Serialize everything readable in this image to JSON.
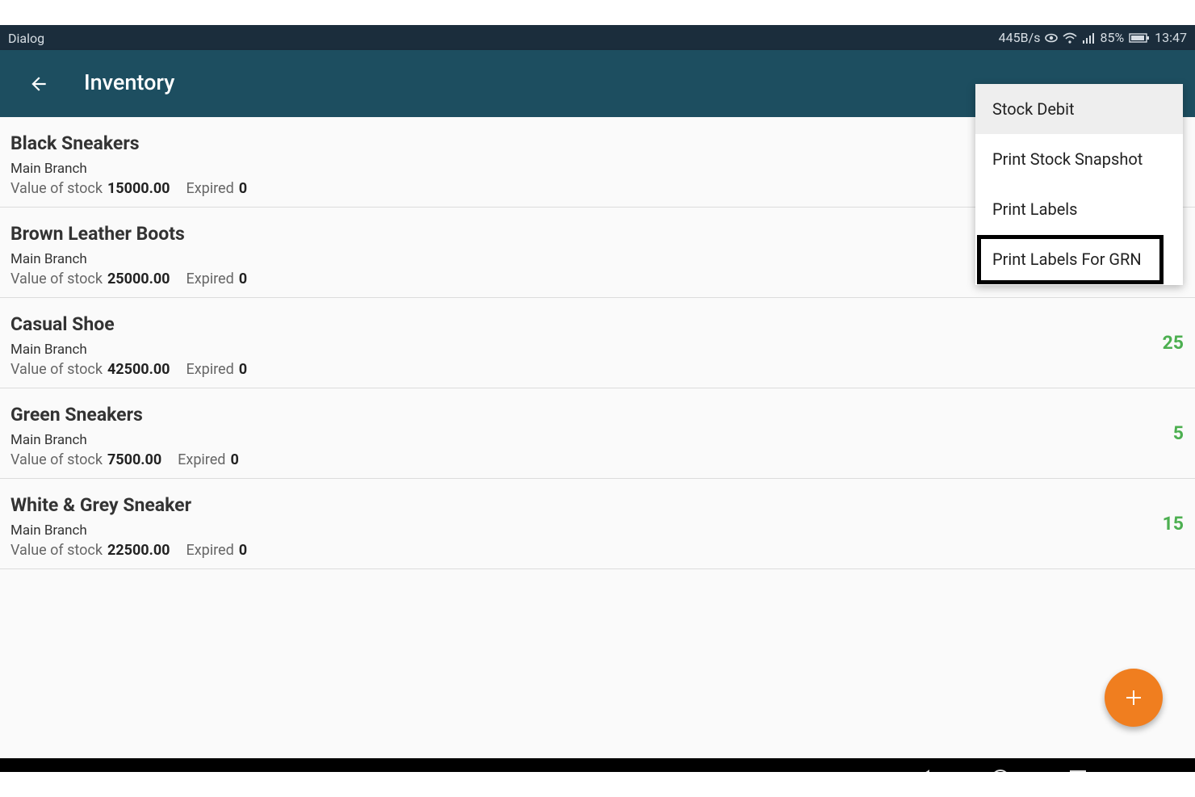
{
  "status_bar": {
    "carrier": "Dialog",
    "net_speed": "445B/s",
    "battery": "85%",
    "time": "13:47"
  },
  "app_bar": {
    "title": "Inventory"
  },
  "items": [
    {
      "name": "Black Sneakers",
      "branch": "Main Branch",
      "value_label": "Value of stock",
      "value": "15000.00",
      "expired_label": "Expired",
      "expired": "0",
      "count": ""
    },
    {
      "name": "Brown Leather Boots",
      "branch": "Main Branch",
      "value_label": "Value of stock",
      "value": "25000.00",
      "expired_label": "Expired",
      "expired": "0",
      "count": ""
    },
    {
      "name": "Casual Shoe",
      "branch": "Main Branch",
      "value_label": "Value of stock",
      "value": "42500.00",
      "expired_label": "Expired",
      "expired": "0",
      "count": "25"
    },
    {
      "name": "Green Sneakers",
      "branch": "Main Branch",
      "value_label": "Value of stock",
      "value": "7500.00",
      "expired_label": "Expired",
      "expired": "0",
      "count": "5"
    },
    {
      "name": "White & Grey Sneaker",
      "branch": "Main Branch",
      "value_label": "Value of stock",
      "value": "22500.00",
      "expired_label": "Expired",
      "expired": "0",
      "count": "15"
    }
  ],
  "menu": {
    "items": [
      "Stock Debit",
      "Print Stock Snapshot",
      "Print Labels",
      "Print Labels For GRN"
    ],
    "active_index": 0,
    "highlighted_index": 3
  },
  "colors": {
    "status_bar": "#1b2d3c",
    "app_bar": "#1d4e60",
    "count_green": "#4caf50",
    "fab_orange": "#f07e1f"
  },
  "icons": {
    "back": "arrow-left-icon",
    "fab": "plus-icon",
    "nav_back": "triangle-back-icon",
    "nav_home": "circle-home-icon",
    "nav_recents": "square-recents-icon"
  }
}
